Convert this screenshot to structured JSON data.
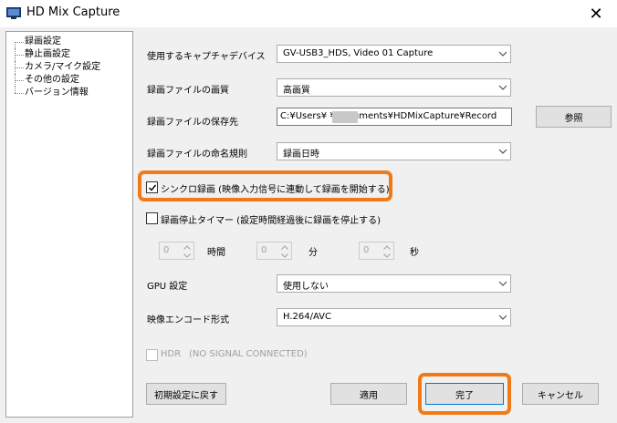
{
  "window": {
    "title": "HD Mix Capture",
    "close_glyph": "✕"
  },
  "sidebar": {
    "items": [
      {
        "label": "録画設定"
      },
      {
        "label": "静止画設定"
      },
      {
        "label": "カメラ/マイク設定"
      },
      {
        "label": "その他の設定"
      },
      {
        "label": "バージョン情報"
      }
    ]
  },
  "settings": {
    "device": {
      "label": "使用するキャプチャデバイス",
      "value": "GV-USB3_HDS, Video 01 Capture"
    },
    "quality": {
      "label": "録画ファイルの画質",
      "value": "高画質"
    },
    "save_path": {
      "label": "録画ファイルの保存先",
      "value": "C:¥Users¥          ¥Documents¥HDMixCapture¥Record",
      "browse_label": "参照"
    },
    "naming": {
      "label": "録画ファイルの命名規則",
      "value": "録画日時"
    },
    "sync_record": {
      "label": "シンクロ録画 (映像入力信号に連動して録画を開始する)",
      "checked": true
    },
    "stop_timer": {
      "label": "録画停止タイマー (設定時間経過後に録画を停止する)",
      "checked": false,
      "hours": {
        "value": "0",
        "unit": "時間"
      },
      "minutes": {
        "value": "0",
        "unit": "分"
      },
      "seconds": {
        "value": "0",
        "unit": "秒"
      }
    },
    "gpu": {
      "label": "GPU 設定",
      "value": "使用しない"
    },
    "encoding": {
      "label": "映像エンコード形式",
      "value": "H.264/AVC"
    },
    "hdr": {
      "label": "HDR",
      "status": "(NO SIGNAL CONNECTED)",
      "checked": false
    }
  },
  "buttons": {
    "reset": "初期設定に戻す",
    "apply": "適用",
    "done": "完了",
    "cancel": "キャンセル"
  },
  "icons": {
    "app": "capture-app-icon",
    "close": "close-icon",
    "dropdown": "chevron-down-icon",
    "check": "checkmark-icon",
    "spin_up": "spin-up-icon",
    "spin_down": "spin-down-icon"
  },
  "colors": {
    "highlight": "#f07a1a",
    "focus": "#0078d7"
  }
}
